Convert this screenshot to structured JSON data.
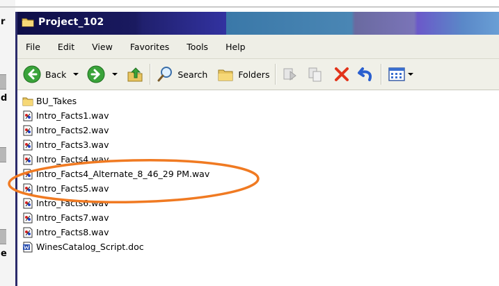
{
  "window": {
    "title": "Project_102"
  },
  "menu": [
    "File",
    "Edit",
    "View",
    "Favorites",
    "Tools",
    "Help"
  ],
  "toolbar": {
    "back_label": "Back",
    "search_label": "Search",
    "folders_label": "Folders"
  },
  "files": [
    {
      "name": "BU_Takes",
      "type": "folder"
    },
    {
      "name": "Intro_Facts1.wav",
      "type": "wav"
    },
    {
      "name": "Intro_Facts2.wav",
      "type": "wav"
    },
    {
      "name": "Intro_Facts3.wav",
      "type": "wav"
    },
    {
      "name": "Intro_Facts4.wav",
      "type": "wav"
    },
    {
      "name": "Intro_Facts4_Alternate_8_46_29 PM.wav",
      "type": "wav"
    },
    {
      "name": "Intro_Facts5.wav",
      "type": "wav"
    },
    {
      "name": "Intro_Facts6.wav",
      "type": "wav"
    },
    {
      "name": "Intro_Facts7.wav",
      "type": "wav"
    },
    {
      "name": "Intro_Facts8.wav",
      "type": "wav"
    },
    {
      "name": "WinesCatalog_Script.doc",
      "type": "doc"
    }
  ],
  "annotation": {
    "color": "#f07a22",
    "encircled_files": [
      "Intro_Facts4.wav",
      "Intro_Facts4_Alternate_8_46_29 PM.wav"
    ]
  }
}
